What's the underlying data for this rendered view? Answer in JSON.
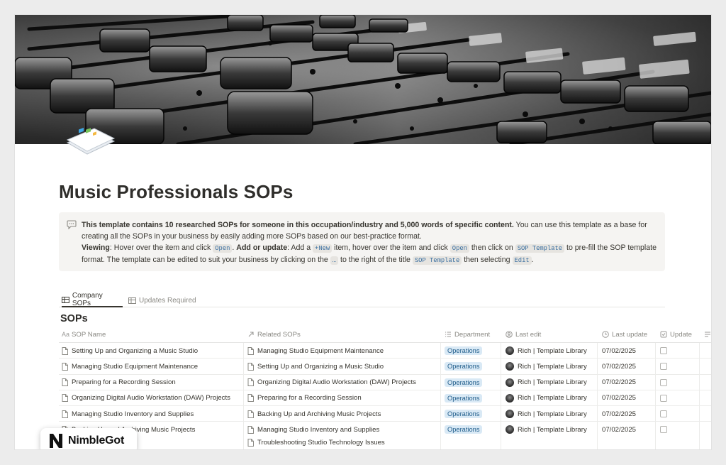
{
  "page": {
    "title": "Music Professionals SOPs"
  },
  "callout": {
    "icon": "speech-bubble-icon",
    "line1_bold": "This template contains 10 researched SOPs for someone in this occupation/industry and 5,000 words of specific content.",
    "line1_rest": " You can use this template as a base for creating all the SOPs in your business by easily adding more SOPs based on our best-practice format.",
    "viewing_label": "Viewing",
    "viewing_text": ": Hover over the item and click ",
    "open_code": "Open",
    "add_label": "Add or update",
    "add_text": ": Add a ",
    "new_code": "+New",
    "add_text2": " item, hover over the item and click ",
    "open_code2": "Open",
    "add_text3": " then click on ",
    "sop_template_code": "SOP Template",
    "add_text4": " to pre-fill the SOP template format. The template can be edited to suit your business by clicking on the ",
    "dots_code": "…",
    "add_text5": " to the right of the title ",
    "sop_template_code2": "SOP Template",
    "add_text6": " then selecting ",
    "edit_code": "Edit",
    "add_text7": "."
  },
  "tabs": [
    {
      "label": "Company SOPs",
      "icon": "table-icon"
    },
    {
      "label": "Updates Required",
      "icon": "table-icon"
    }
  ],
  "database": {
    "title": "SOPs",
    "columns": [
      {
        "label": "SOP Name",
        "icon": "Aa"
      },
      {
        "label": "Related SOPs",
        "icon": "arrow-up-right-icon"
      },
      {
        "label": "Department",
        "icon": "list-icon"
      },
      {
        "label": "Last edit",
        "icon": "person-icon"
      },
      {
        "label": "Last update",
        "icon": "clock-icon"
      },
      {
        "label": "Update",
        "icon": "checkbox-icon"
      }
    ],
    "rows": [
      {
        "name": "Setting Up and Organizing a Music Studio",
        "related": [
          "Managing Studio Equipment Maintenance"
        ],
        "department": "Operations",
        "editor": "Rich | Template Library",
        "date": "07/02/2025"
      },
      {
        "name": "Managing Studio Equipment Maintenance",
        "related": [
          "Setting Up and Organizing a Music Studio"
        ],
        "department": "Operations",
        "editor": "Rich | Template Library",
        "date": "07/02/2025"
      },
      {
        "name": "Preparing for a Recording Session",
        "related": [
          "Organizing Digital Audio Workstation (DAW) Projects"
        ],
        "department": "Operations",
        "editor": "Rich | Template Library",
        "date": "07/02/2025"
      },
      {
        "name": "Organizing Digital Audio Workstation (DAW) Projects",
        "related": [
          "Preparing for a Recording Session"
        ],
        "department": "Operations",
        "editor": "Rich | Template Library",
        "date": "07/02/2025"
      },
      {
        "name": "Managing Studio Inventory and Supplies",
        "related": [
          "Backing Up and Archiving Music Projects"
        ],
        "department": "Operations",
        "editor": "Rich | Template Library",
        "date": "07/02/2025"
      },
      {
        "name": "Backing Up and Archiving Music Projects",
        "related": [
          "Managing Studio Inventory and Supplies",
          "Troubleshooting Studio Technology Issues"
        ],
        "department": "Operations",
        "editor": "Rich | Template Library",
        "date": "07/02/2025"
      }
    ]
  },
  "watermark": {
    "text": "NimbleGot"
  }
}
